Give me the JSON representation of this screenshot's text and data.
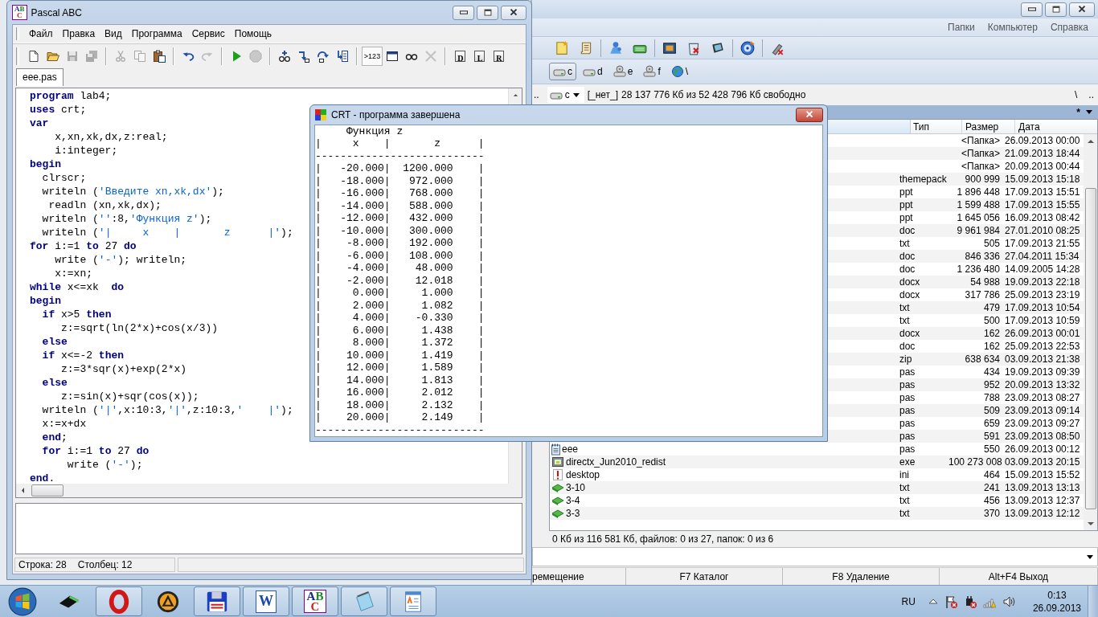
{
  "file_manager": {
    "menu": [
      "Папки",
      "Компьютер",
      "Справка"
    ],
    "toolbar": [
      [
        {
          "kind": "note"
        },
        {
          "kind": "scroll"
        }
      ],
      [
        {
          "kind": "network"
        },
        {
          "kind": "drive"
        }
      ],
      [
        {
          "kind": "picture"
        },
        {
          "kind": "recycle"
        },
        {
          "kind": "monitor"
        }
      ],
      [
        {
          "kind": "disc"
        }
      ],
      [
        {
          "kind": "usb"
        }
      ]
    ],
    "drives": [
      {
        "kind": "hdd",
        "label": "c",
        "selected": true
      },
      {
        "kind": "hdd",
        "label": "d",
        "selected": false
      },
      {
        "kind": "cd",
        "label": "e",
        "selected": false
      },
      {
        "kind": "cd",
        "label": "f",
        "selected": false
      },
      {
        "kind": "net",
        "label": "\\",
        "selected": false
      }
    ],
    "path_bar": {
      "up": "..",
      "drive": "c",
      "volume": "[_нет_]",
      "free_space": "28 137 776 Кб из 52 428 796 Кб свободно",
      "root": "\\",
      "parent": ".."
    },
    "panel_header": {
      "filter": "*"
    },
    "columns": [
      "Тип",
      "Размер",
      "Дата"
    ],
    "rows": [
      {
        "type": "",
        "size": "<Папка>",
        "date": "26.09.2013 00:00"
      },
      {
        "type": "",
        "size": "<Папка>",
        "date": "21.09.2013 18:44"
      },
      {
        "type": "",
        "size": "<Папка>",
        "date": "20.09.2013 00:44"
      },
      {
        "type": "themepack",
        "size": "900 999",
        "date": "15.09.2013 15:18"
      },
      {
        "type": "ppt",
        "size": "1 896 448",
        "date": "17.09.2013 15:51"
      },
      {
        "type": "ppt",
        "size": "1 599 488",
        "date": "17.09.2013 15:55"
      },
      {
        "type": "ppt",
        "size": "1 645 056",
        "date": "16.09.2013 08:42"
      },
      {
        "type": "doc",
        "size": "9 961 984",
        "date": "27.01.2010 08:25"
      },
      {
        "type": "txt",
        "size": "505",
        "date": "17.09.2013 21:55"
      },
      {
        "type": "doc",
        "size": "846 336",
        "date": "27.04.2011 15:34"
      },
      {
        "type": "doc",
        "size": "1 236 480",
        "date": "14.09.2005 14:28"
      },
      {
        "type": "docx",
        "size": "54 988",
        "date": "19.09.2013 22:18"
      },
      {
        "type": "docx",
        "size": "317 786",
        "date": "25.09.2013 23:19"
      },
      {
        "type": "txt",
        "size": "479",
        "date": "17.09.2013 10:54"
      },
      {
        "type": "txt",
        "size": "500",
        "date": "17.09.2013 10:59"
      },
      {
        "type": "docx",
        "size": "162",
        "date": "26.09.2013 00:01"
      },
      {
        "type": "doc",
        "size": "162",
        "date": "25.09.2013 22:53"
      },
      {
        "type": "zip",
        "size": "638 634",
        "date": "03.09.2013 21:38"
      },
      {
        "type": "pas",
        "size": "434",
        "date": "19.09.2013 09:39"
      },
      {
        "type": "pas",
        "size": "952",
        "date": "20.09.2013 13:32"
      },
      {
        "type": "pas",
        "size": "788",
        "date": "23.09.2013 08:27"
      },
      {
        "type": "pas",
        "size": "509",
        "date": "23.09.2013 09:14"
      },
      {
        "type": "pas",
        "size": "659",
        "date": "23.09.2013 09:27"
      },
      {
        "type": "pas",
        "size": "591",
        "date": "23.09.2013 08:50"
      },
      {
        "name": "eee",
        "type": "pas",
        "size": "550",
        "date": "26.09.2013 00:12"
      },
      {
        "name": "directx_Jun2010_redist",
        "type": "exe",
        "size": "100 273 008",
        "date": "03.09.2013 20:15"
      },
      {
        "name": "desktop",
        "type": "ini",
        "size": "464",
        "date": "15.09.2013 15:52"
      },
      {
        "name": "3-10",
        "type": "txt",
        "size": "241",
        "date": "13.09.2013 13:13"
      },
      {
        "name": "3-4",
        "type": "txt",
        "size": "456",
        "date": "13.09.2013 12:37"
      },
      {
        "name": "3-3",
        "type": "txt",
        "size": "370",
        "date": "13.09.2013 12:12"
      }
    ],
    "summary": "0 Кб из 116 581 Кб, файлов: 0 из 27, папок: 0 из 6",
    "function_keys": [
      "ремещение",
      "F7 Каталог",
      "F8 Удаление",
      "Alt+F4 Выход"
    ]
  },
  "pascal_window": {
    "title": "Pascal ABC",
    "icon_letters": "ABC",
    "menu": [
      "Файл",
      "Правка",
      "Вид",
      "Программа",
      "Сервис",
      "Помощь"
    ],
    "toolbar": [
      [
        {
          "kind": "new",
          "disabled": false,
          "pressed": false
        },
        {
          "kind": "open",
          "disabled": false,
          "pressed": false
        },
        {
          "kind": "save",
          "disabled": true,
          "pressed": false
        },
        {
          "kind": "saveall",
          "disabled": true,
          "pressed": false
        }
      ],
      [
        {
          "kind": "cut",
          "disabled": true,
          "pressed": false
        },
        {
          "kind": "copy",
          "disabled": true,
          "pressed": false
        },
        {
          "kind": "paste",
          "disabled": false,
          "pressed": false
        }
      ],
      [
        {
          "kind": "undo",
          "disabled": false,
          "pressed": false
        },
        {
          "kind": "redo",
          "disabled": true,
          "pressed": false
        }
      ],
      [
        {
          "kind": "run",
          "disabled": false,
          "pressed": false
        },
        {
          "kind": "stop",
          "disabled": true,
          "pressed": false
        }
      ],
      [
        {
          "kind": "watch",
          "disabled": false,
          "pressed": false
        },
        {
          "kind": "stepin",
          "disabled": false,
          "pressed": false
        },
        {
          "kind": "stepover",
          "disabled": false,
          "pressed": false
        },
        {
          "kind": "runto",
          "disabled": false,
          "pressed": false
        }
      ],
      [
        {
          "kind": "output",
          "label": ">123",
          "disabled": false,
          "pressed": true
        },
        {
          "kind": "window",
          "disabled": false,
          "pressed": false
        },
        {
          "kind": "glasses",
          "disabled": false,
          "pressed": false
        },
        {
          "kind": "delete",
          "disabled": true,
          "pressed": false
        }
      ],
      [
        {
          "kind": "page",
          "label": "D",
          "disabled": false,
          "pressed": false
        },
        {
          "kind": "page",
          "label": "L",
          "disabled": false,
          "pressed": false
        },
        {
          "kind": "page",
          "label": "R",
          "disabled": false,
          "pressed": false
        }
      ]
    ],
    "tabs": [
      {
        "label": "eee.pas",
        "selected": true
      }
    ],
    "code_lines": [
      [
        {
          "kind": "keyword",
          "text": "program"
        },
        {
          "kind": "plain",
          "text": " lab4;"
        }
      ],
      [
        {
          "kind": "keyword",
          "text": "uses"
        },
        {
          "kind": "plain",
          "text": " crt;"
        }
      ],
      [
        {
          "kind": "keyword",
          "text": "var"
        }
      ],
      [
        {
          "kind": "plain",
          "text": "    x,xn,xk,dx,z:real;"
        }
      ],
      [
        {
          "kind": "plain",
          "text": "    i:integer;"
        }
      ],
      [
        {
          "kind": "keyword",
          "text": "begin"
        }
      ],
      [
        {
          "kind": "plain",
          "text": "  clrscr;"
        }
      ],
      [
        {
          "kind": "plain",
          "text": "  writeln ("
        },
        {
          "kind": "string",
          "text": "'Введите xn,xk,dx'"
        },
        {
          "kind": "plain",
          "text": ");"
        }
      ],
      [
        {
          "kind": "plain",
          "text": "   readln (xn,xk,dx);"
        }
      ],
      [
        {
          "kind": "plain",
          "text": "  writeln ("
        },
        {
          "kind": "string",
          "text": "''"
        },
        {
          "kind": "plain",
          "text": ":8,"
        },
        {
          "kind": "string",
          "text": "'Функция z'"
        },
        {
          "kind": "plain",
          "text": ");"
        }
      ],
      [
        {
          "kind": "plain",
          "text": "  writeln ("
        },
        {
          "kind": "string",
          "text": "'|     x    |       z      |'"
        },
        {
          "kind": "plain",
          "text": ");"
        }
      ],
      [
        {
          "kind": "keyword",
          "text": "for"
        },
        {
          "kind": "plain",
          "text": " i:=1 "
        },
        {
          "kind": "keyword",
          "text": "to"
        },
        {
          "kind": "plain",
          "text": " 27 "
        },
        {
          "kind": "keyword",
          "text": "do"
        }
      ],
      [
        {
          "kind": "plain",
          "text": "    write ("
        },
        {
          "kind": "string",
          "text": "'-'"
        },
        {
          "kind": "plain",
          "text": "); writeln;"
        }
      ],
      [
        {
          "kind": "plain",
          "text": "    x:=xn;"
        }
      ],
      [
        {
          "kind": "keyword",
          "text": "while"
        },
        {
          "kind": "plain",
          "text": " x<=xk  "
        },
        {
          "kind": "keyword",
          "text": "do"
        }
      ],
      [
        {
          "kind": "keyword",
          "text": "begin"
        }
      ],
      [
        {
          "kind": "keyword",
          "text": "  if"
        },
        {
          "kind": "plain",
          "text": " x>5 "
        },
        {
          "kind": "keyword",
          "text": "then"
        }
      ],
      [
        {
          "kind": "plain",
          "text": "     z:=sqrt(ln(2*x)+cos(x/3))"
        }
      ],
      [
        {
          "kind": "keyword",
          "text": "  else"
        }
      ],
      [
        {
          "kind": "keyword",
          "text": "  if"
        },
        {
          "kind": "plain",
          "text": " x<=-2 "
        },
        {
          "kind": "keyword",
          "text": "then"
        }
      ],
      [
        {
          "kind": "plain",
          "text": "     z:=3*sqr(x)+exp(2*x)"
        }
      ],
      [
        {
          "kind": "keyword",
          "text": "  else"
        }
      ],
      [
        {
          "kind": "plain",
          "text": "     z:=sin(x)+sqr(cos(x));"
        }
      ],
      [
        {
          "kind": "plain",
          "text": "  writeln ("
        },
        {
          "kind": "string",
          "text": "'|'"
        },
        {
          "kind": "plain",
          "text": ",x:10:3,"
        },
        {
          "kind": "string",
          "text": "'|'"
        },
        {
          "kind": "plain",
          "text": ",z:10:3,"
        },
        {
          "kind": "string",
          "text": "'    |'"
        },
        {
          "kind": "plain",
          "text": ");"
        }
      ],
      [
        {
          "kind": "plain",
          "text": "  x:=x+dx"
        }
      ],
      [
        {
          "kind": "keyword",
          "text": "  end"
        },
        {
          "kind": "plain",
          "text": ";"
        }
      ],
      [
        {
          "kind": "keyword",
          "text": "  for"
        },
        {
          "kind": "plain",
          "text": " i:=1 "
        },
        {
          "kind": "keyword",
          "text": "to"
        },
        {
          "kind": "plain",
          "text": " 27 "
        },
        {
          "kind": "keyword",
          "text": "do"
        }
      ],
      [
        {
          "kind": "plain",
          "text": "      write ("
        },
        {
          "kind": "string",
          "text": "'-'"
        },
        {
          "kind": "plain",
          "text": ");"
        }
      ],
      [
        {
          "kind": "keyword",
          "text": "end"
        },
        {
          "kind": "plain",
          "text": "."
        }
      ]
    ],
    "status": {
      "line": "Строка: 28",
      "column": "Столбец: 12"
    }
  },
  "crt_window": {
    "title": "CRT - программа завершена",
    "output_lines": [
      "     Функция z",
      "|     x    |       z      |",
      "---------------------------",
      "|   -20.000|  1200.000    |",
      "|   -18.000|   972.000    |",
      "|   -16.000|   768.000    |",
      "|   -14.000|   588.000    |",
      "|   -12.000|   432.000    |",
      "|   -10.000|   300.000    |",
      "|    -8.000|   192.000    |",
      "|    -6.000|   108.000    |",
      "|    -4.000|    48.000    |",
      "|    -2.000|    12.018    |",
      "|     0.000|     1.000    |",
      "|     2.000|     1.082    |",
      "|     4.000|    -0.330    |",
      "|     6.000|     1.438    |",
      "|     8.000|     1.372    |",
      "|    10.000|     1.419    |",
      "|    12.000|     1.589    |",
      "|    14.000|     1.813    |",
      "|    16.000|     2.012    |",
      "|    18.000|     2.132    |",
      "|    20.000|     2.149    |",
      "---------------------------"
    ]
  },
  "taskbar": {
    "items": [
      {
        "kind": "drive",
        "running": false
      },
      {
        "kind": "ring",
        "running": true
      },
      {
        "kind": "triangle",
        "running": false
      },
      {
        "kind": "floppy",
        "running": true
      },
      {
        "kind": "document",
        "label": "W",
        "running": true
      },
      {
        "kind": "letters",
        "label": "ABC",
        "running": true
      },
      {
        "kind": "notepad",
        "running": true
      },
      {
        "kind": "wordpad",
        "running": true
      }
    ],
    "tray": {
      "language": "RU",
      "time": "0:13",
      "date": "26.09.2013"
    }
  }
}
